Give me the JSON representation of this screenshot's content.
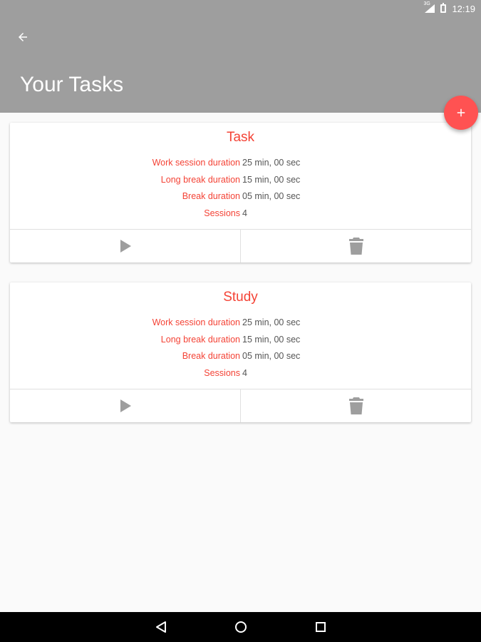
{
  "status": {
    "time": "12:19",
    "network": "3G"
  },
  "header": {
    "title": "Your Tasks"
  },
  "labels": {
    "work": "Work session duration",
    "long_break": "Long break duration",
    "break": "Break duration",
    "sessions": "Sessions"
  },
  "tasks": [
    {
      "title": "Task",
      "work": "25 min, 00 sec",
      "long_break": "15 min, 00 sec",
      "break": "05 min, 00 sec",
      "sessions": "4"
    },
    {
      "title": "Study",
      "work": "25 min, 00 sec",
      "long_break": "15 min, 00 sec",
      "break": "05 min, 00 sec",
      "sessions": "4"
    }
  ],
  "colors": {
    "accent": "#f44336",
    "fab": "#ff5252",
    "app_bar": "#9e9e9e",
    "icon": "#9e9e9e"
  },
  "icons": {
    "back": "arrow-back-icon",
    "add": "plus-icon",
    "play": "play-icon",
    "delete": "trash-icon",
    "nav_back": "triangle-back-icon",
    "nav_home": "circle-home-icon",
    "nav_recent": "square-recent-icon"
  }
}
